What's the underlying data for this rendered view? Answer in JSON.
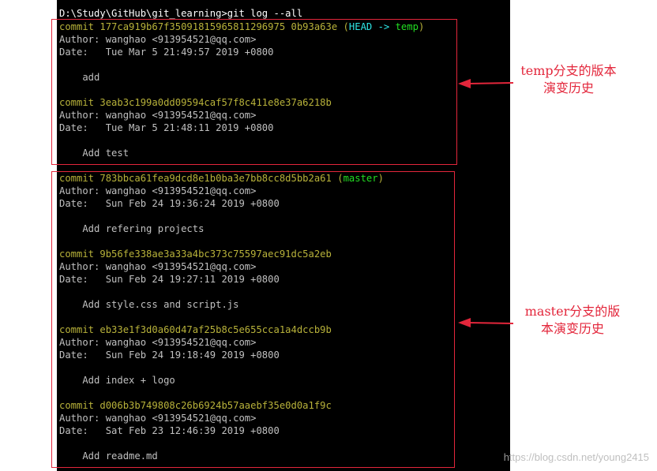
{
  "terminal": {
    "prompt": "D:\\Study\\GitHub\\git_learning>git log --all",
    "commits": [
      {
        "hash": "commit 177ca919b67f35091815965811296975 0b93a63e",
        "refs_open": " (",
        "ref_head": "HEAD -> ",
        "ref_branch": "temp",
        "refs_close": ")",
        "author": "Author: wanghao <913954521@qq.com>",
        "date": "Date:   Tue Mar 5 21:49:57 2019 +0800",
        "message": "    add"
      },
      {
        "hash": "commit 3eab3c199a0dd09594caf57f8c411e8e37a6218b",
        "author": "Author: wanghao <913954521@qq.com>",
        "date": "Date:   Tue Mar 5 21:48:11 2019 +0800",
        "message": "    Add test"
      },
      {
        "hash": "commit 783bbca61fea9dcd8e1b0ba3e7bb8cc8d5bb2a61",
        "refs_open": " (",
        "ref_branch": "master",
        "refs_close": ")",
        "author": "Author: wanghao <913954521@qq.com>",
        "date": "Date:   Sun Feb 24 19:36:24 2019 +0800",
        "message": "    Add refering projects"
      },
      {
        "hash": "commit 9b56fe338ae3a33a4bc373c75597aec91dc5a2eb",
        "author": "Author: wanghao <913954521@qq.com>",
        "date": "Date:   Sun Feb 24 19:27:11 2019 +0800",
        "message": "    Add style.css and script.js"
      },
      {
        "hash": "commit eb33e1f3d0a60d47af25b8c5e655cca1a4dccb9b",
        "author": "Author: wanghao <913954521@qq.com>",
        "date": "Date:   Sun Feb 24 19:18:49 2019 +0800",
        "message": "    Add index + logo"
      },
      {
        "hash": "commit d006b3b749808c26b6924b57aaebf35e0d0a1f9c",
        "author": "Author: wanghao <913954521@qq.com>",
        "date": "Date:   Sat Feb 23 12:46:39 2019 +0800",
        "message": "    Add readme.md"
      }
    ]
  },
  "annotations": {
    "temp_line1": "temp分支的版本",
    "temp_line2": "演变历史",
    "master_line1": "master分支的版",
    "master_line2": "本演变历史"
  },
  "colors": {
    "annotation_red": "#e3263b",
    "commit_yellow": "#b8b23a",
    "head_cyan": "#2ee6e6",
    "branch_green": "#22dd22"
  },
  "watermark": "https://blog.csdn.net/young2415"
}
